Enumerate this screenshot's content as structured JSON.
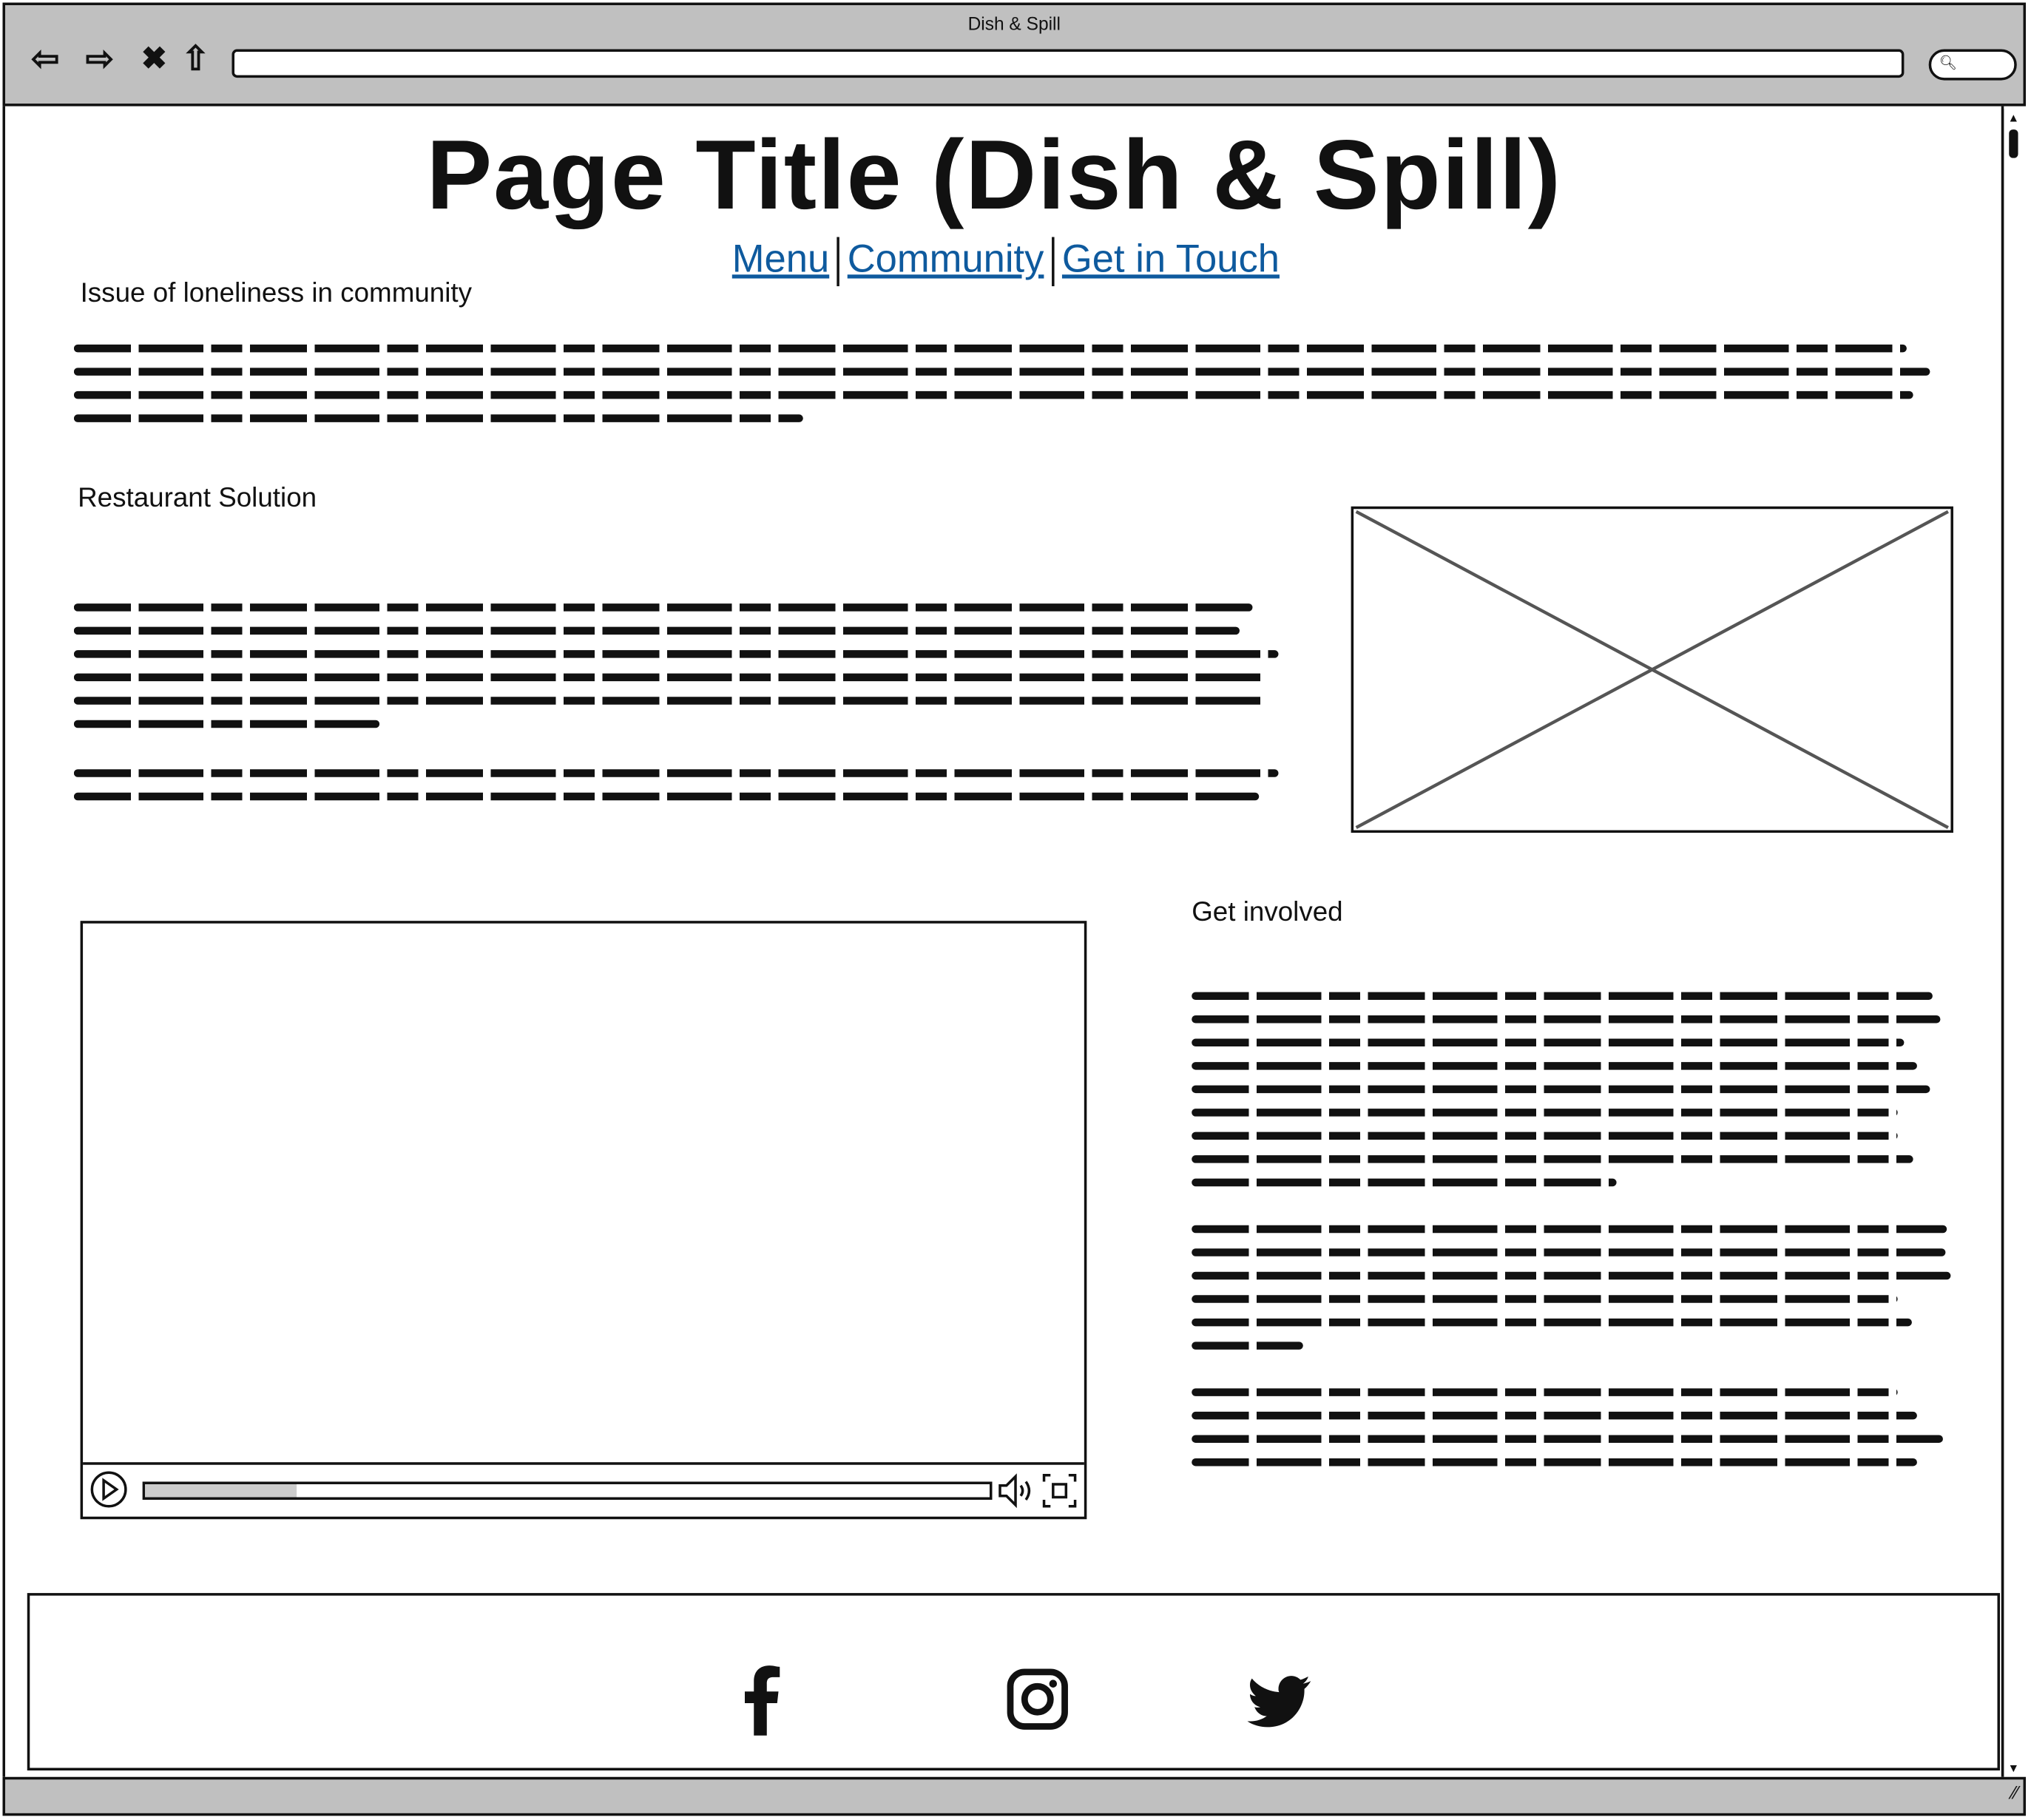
{
  "browser": {
    "window_title": "Dish & Spill",
    "url": "",
    "progress_note": ""
  },
  "page": {
    "title": "Page Title (Dish & Spill)",
    "nav": [
      "Menu",
      "Community",
      "Get in Touch"
    ],
    "sections": {
      "loneliness": {
        "heading": "Issue of loneliness in community"
      },
      "solution": {
        "heading": "Restaurant Solution",
        "image": "image-placeholder"
      },
      "involved": {
        "heading": "Get involved"
      }
    },
    "video": {
      "progress_percent": 18
    },
    "footer": {
      "social_icons": [
        "facebook-icon",
        "instagram-icon",
        "twitter-icon"
      ]
    }
  },
  "colors": {
    "link": "#0e5a9e",
    "chrome": "#c0c0c0",
    "progress": "#cccccc"
  }
}
